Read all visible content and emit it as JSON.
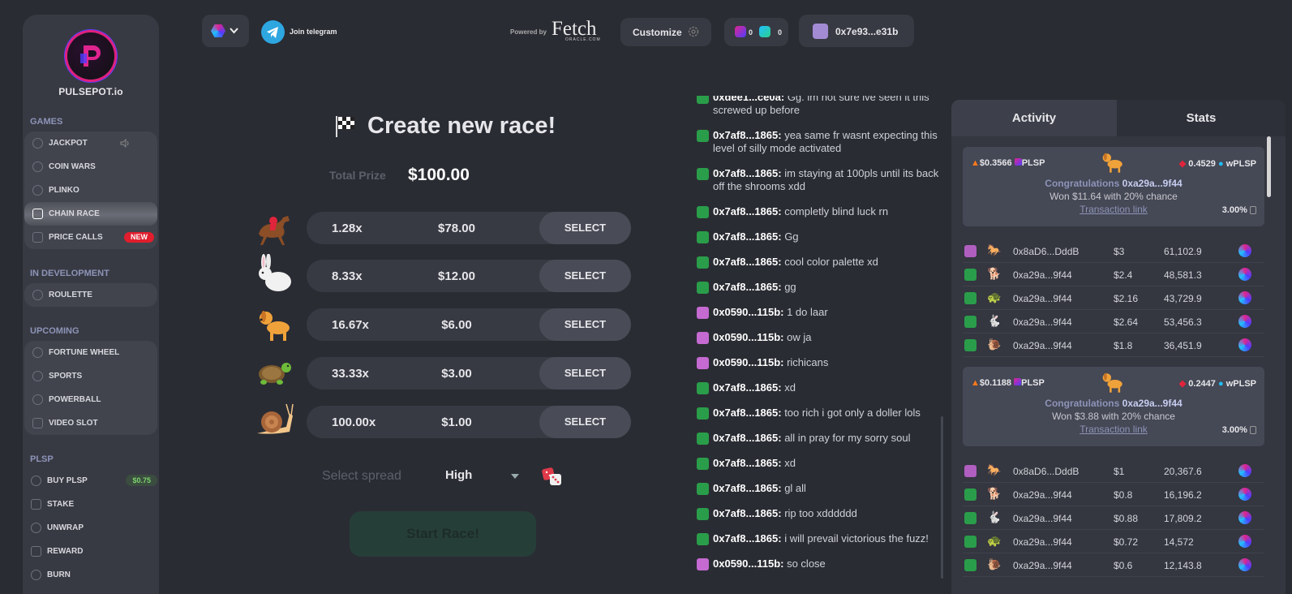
{
  "brand": {
    "name": "PULSEPOT.io"
  },
  "sidebar": {
    "games_title": "GAMES",
    "games": [
      {
        "label": "JACKPOT",
        "icon": "jackpot-icon"
      },
      {
        "label": "COIN WARS",
        "icon": "coin-icon"
      },
      {
        "label": "PLINKO",
        "icon": "plinko-icon"
      },
      {
        "label": "CHAIN RACE",
        "icon": "flag-icon",
        "active": true
      },
      {
        "label": "PRICE CALLS",
        "icon": "chart-icon",
        "badge": "NEW"
      }
    ],
    "dev_title": "IN DEVELOPMENT",
    "dev": [
      {
        "label": "ROULETTE",
        "icon": "roulette-icon"
      }
    ],
    "upcoming_title": "UPCOMING",
    "upcoming": [
      {
        "label": "FORTUNE WHEEL",
        "icon": "wheel-icon"
      },
      {
        "label": "SPORTS",
        "icon": "sports-icon"
      },
      {
        "label": "POWERBALL",
        "icon": "ball-icon"
      },
      {
        "label": "VIDEO SLOT",
        "icon": "slot-icon"
      }
    ],
    "plsp_title": "PLSP",
    "plsp": [
      {
        "label": "BUY PLSP",
        "icon": "buy-icon",
        "price": "$0.75"
      },
      {
        "label": "STAKE",
        "icon": "lock-icon"
      },
      {
        "label": "UNWRAP",
        "icon": "unwrap-icon"
      },
      {
        "label": "REWARD",
        "icon": "gift-icon"
      },
      {
        "label": "BURN",
        "icon": "fire-icon"
      }
    ]
  },
  "topbar": {
    "telegram": "Join telegram",
    "powered_by": "Powered by",
    "fetch_logo": "Fetch",
    "fetch_sub": "ORACLE.COM",
    "customize": "Customize",
    "balance_plsp": "0",
    "balance_wplsp": "0",
    "wallet": "0x7e93...e31b"
  },
  "race": {
    "title": "Create new race!",
    "prize_label": "Total Prize",
    "prize_value": "$100.00",
    "select_label": "SELECT",
    "runners": [
      {
        "animal": "horse-icon",
        "multiplier": "1.28x",
        "amount": "$78.00"
      },
      {
        "animal": "rabbit-icon",
        "multiplier": "8.33x",
        "amount": "$12.00"
      },
      {
        "animal": "dog-icon",
        "multiplier": "16.67x",
        "amount": "$6.00"
      },
      {
        "animal": "turtle-icon",
        "multiplier": "33.33x",
        "amount": "$3.00"
      },
      {
        "animal": "snail-icon",
        "multiplier": "100.00x",
        "amount": "$1.00"
      }
    ],
    "spread_label": "Select spread",
    "spread_value": "High",
    "start_label": "Start Race!"
  },
  "chat": [
    {
      "user": "0xdee1...ce0a",
      "text": "Gg. im not sure ive seen it this screwed up before",
      "color": "#2a9d4a"
    },
    {
      "user": "0x7af8...1865",
      "text": "yea same fr wasnt expecting this level of silly mode activated",
      "color": "#2a9d4a"
    },
    {
      "user": "0x7af8...1865",
      "text": "im staying at 100pls until its back off the shrooms xdd",
      "color": "#2a9d4a"
    },
    {
      "user": "0x7af8...1865",
      "text": "completly blind luck rn",
      "color": "#2a9d4a"
    },
    {
      "user": "0x7af8...1865",
      "text": "Gg",
      "color": "#2a9d4a"
    },
    {
      "user": "0x7af8...1865",
      "text": "cool color palette xd",
      "color": "#2a9d4a"
    },
    {
      "user": "0x7af8...1865",
      "text": "gg",
      "color": "#2a9d4a"
    },
    {
      "user": "0x0590...115b",
      "text": "1 do laar",
      "color": "#c46ad1"
    },
    {
      "user": "0x0590...115b",
      "text": "ow ja",
      "color": "#c46ad1"
    },
    {
      "user": "0x0590...115b",
      "text": "richicans",
      "color": "#c46ad1"
    },
    {
      "user": "0x7af8...1865",
      "text": "xd",
      "color": "#2a9d4a"
    },
    {
      "user": "0x7af8...1865",
      "text": "too rich i got only a doller lols",
      "color": "#2a9d4a"
    },
    {
      "user": "0x7af8...1865",
      "text": "all in pray for my sorry soul",
      "color": "#2a9d4a"
    },
    {
      "user": "0x7af8...1865",
      "text": "xd",
      "color": "#2a9d4a"
    },
    {
      "user": "0x7af8...1865",
      "text": "gl all",
      "color": "#2a9d4a"
    },
    {
      "user": "0x7af8...1865",
      "text": "rip too xdddddd",
      "color": "#2a9d4a"
    },
    {
      "user": "0x7af8...1865",
      "text": "i will prevail victorious the fuzz!",
      "color": "#2a9d4a"
    },
    {
      "user": "0x0590...115b",
      "text": "so close",
      "color": "#c46ad1"
    }
  ],
  "activity": {
    "tab_activity": "Activity",
    "tab_stats": "Stats",
    "races": [
      {
        "pot_usd": "$0.3566",
        "pot_token": "PLSP",
        "wplsp": "0.4529",
        "wplsp_label": "wPLSP",
        "congrats_prefix": "Congratulations",
        "winner": "0xa29a...9f44",
        "won_text": "Won $11.64 with 20% chance",
        "tx_label": "Transaction link",
        "fee": "3.00%",
        "rows": [
          {
            "animal": "🐎",
            "addr": "0x8aD6...DddB",
            "bet": "$3",
            "tokens": "61,102.9",
            "av": "#b05ec0"
          },
          {
            "animal": "🐕",
            "addr": "0xa29a...9f44",
            "bet": "$2.4",
            "tokens": "48,581.3",
            "av": "#2a9d4a"
          },
          {
            "animal": "🐢",
            "addr": "0xa29a...9f44",
            "bet": "$2.16",
            "tokens": "43,729.9",
            "av": "#2a9d4a"
          },
          {
            "animal": "🐇",
            "addr": "0xa29a...9f44",
            "bet": "$2.64",
            "tokens": "53,456.3",
            "av": "#2a9d4a"
          },
          {
            "animal": "🐌",
            "addr": "0xa29a...9f44",
            "bet": "$1.8",
            "tokens": "36,451.9",
            "av": "#2a9d4a"
          }
        ]
      },
      {
        "pot_usd": "$0.1188",
        "pot_token": "PLSP",
        "wplsp": "0.2447",
        "wplsp_label": "wPLSP",
        "congrats_prefix": "Congratulations",
        "winner": "0xa29a...9f44",
        "won_text": "Won $3.88 with 20% chance",
        "tx_label": "Transaction link",
        "fee": "3.00%",
        "rows": [
          {
            "animal": "🐎",
            "addr": "0x8aD6...DddB",
            "bet": "$1",
            "tokens": "20,367.6",
            "av": "#b05ec0"
          },
          {
            "animal": "🐕",
            "addr": "0xa29a...9f44",
            "bet": "$0.8",
            "tokens": "16,196.2",
            "av": "#2a9d4a"
          },
          {
            "animal": "🐇",
            "addr": "0xa29a...9f44",
            "bet": "$0.88",
            "tokens": "17,809.2",
            "av": "#2a9d4a"
          },
          {
            "animal": "🐢",
            "addr": "0xa29a...9f44",
            "bet": "$0.72",
            "tokens": "14,572",
            "av": "#2a9d4a"
          },
          {
            "animal": "🐌",
            "addr": "0xa29a...9f44",
            "bet": "$0.6",
            "tokens": "12,143.8",
            "av": "#2a9d4a"
          }
        ]
      }
    ]
  }
}
